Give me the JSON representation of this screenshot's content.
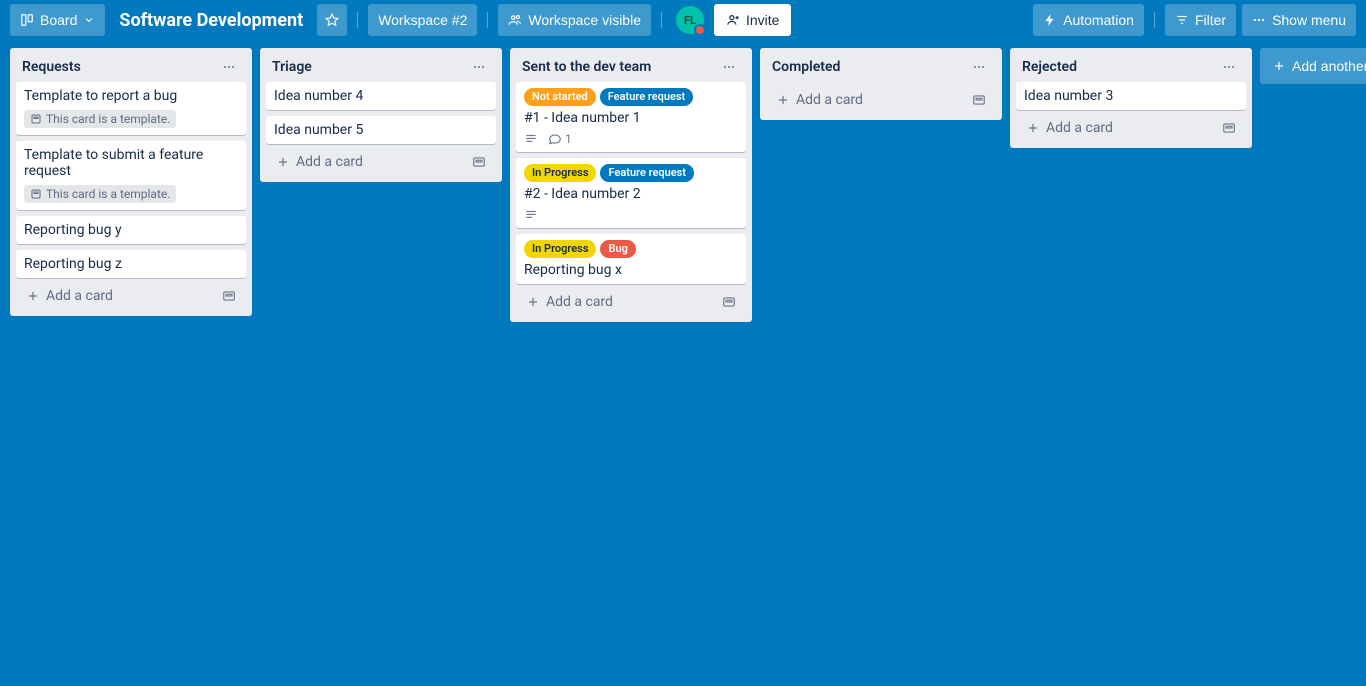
{
  "topbar": {
    "view_switcher_label": "Board",
    "board_title": "Software Development",
    "workspace_button": "Workspace #2",
    "visibility_button": "Workspace visible",
    "avatar_initials": "FL",
    "invite_label": "Invite",
    "automation_label": "Automation",
    "filter_label": "Filter",
    "show_menu_label": "Show menu"
  },
  "add_another_list_label": "Add another list",
  "add_card_label": "Add a card",
  "template_badge_label": "This card is a template.",
  "labels": {
    "not_started": "Not started",
    "in_progress": "In Progress",
    "feature_request": "Feature request",
    "bug": "Bug"
  },
  "lists": [
    {
      "title": "Requests",
      "cards": [
        {
          "title": "Template to report a bug",
          "is_template": true
        },
        {
          "title": "Template to submit a feature request",
          "is_template": true
        },
        {
          "title": "Reporting bug y"
        },
        {
          "title": "Reporting bug z"
        }
      ]
    },
    {
      "title": "Triage",
      "cards": [
        {
          "title": "Idea number 4"
        },
        {
          "title": "Idea number 5"
        }
      ]
    },
    {
      "title": "Sent to the dev team",
      "cards": [
        {
          "title": "#1 - Idea number 1",
          "labels": [
            [
              "orange",
              "not_started"
            ],
            [
              "blue",
              "feature_request"
            ]
          ],
          "has_description": true,
          "comments": 1
        },
        {
          "title": "#2 - Idea number 2",
          "labels": [
            [
              "yellow",
              "in_progress"
            ],
            [
              "blue",
              "feature_request"
            ]
          ],
          "has_description": true
        },
        {
          "title": "Reporting bug x",
          "labels": [
            [
              "yellow",
              "in_progress"
            ],
            [
              "red",
              "bug"
            ]
          ]
        }
      ]
    },
    {
      "title": "Completed",
      "cards": []
    },
    {
      "title": "Rejected",
      "cards": [
        {
          "title": "Idea number 3"
        }
      ]
    }
  ]
}
